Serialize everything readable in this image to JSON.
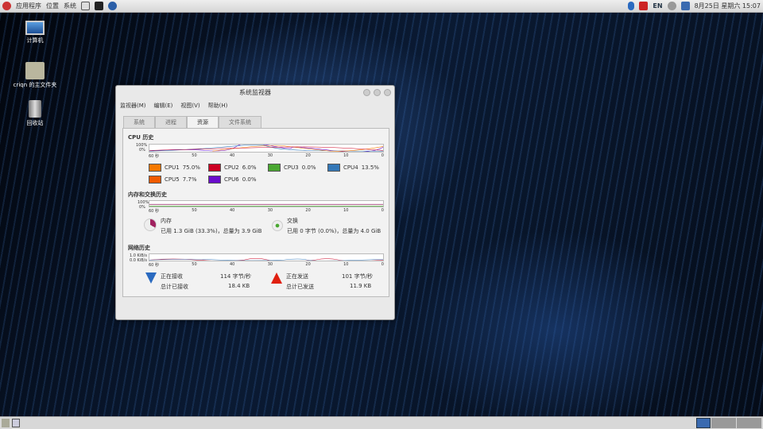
{
  "topbar": {
    "menus": [
      "应用程序",
      "位置",
      "系统"
    ],
    "lang": "EN",
    "clock": "8月25日 星期六 15:07"
  },
  "desktop": [
    {
      "label": "计算机"
    },
    {
      "label": "criqn 的主文件夹"
    },
    {
      "label": "回收站"
    }
  ],
  "window": {
    "title": "系统监视器",
    "menu": [
      "监视器(M)",
      "编辑(E)",
      "视图(V)",
      "帮助(H)"
    ],
    "tabs": [
      "系统",
      "进程",
      "资源",
      "文件系统"
    ],
    "active_tab": 2,
    "cpu": {
      "title": "CPU 历史",
      "y_labels": [
        "100%",
        "0%"
      ],
      "x_labels": [
        "60 秒",
        "50",
        "40",
        "30",
        "20",
        "10",
        "0"
      ],
      "cores": [
        {
          "name": "CPU1",
          "value": "75.0%",
          "color": "#f57900"
        },
        {
          "name": "CPU2",
          "value": "6.0%",
          "color": "#cc0022"
        },
        {
          "name": "CPU3",
          "value": "0.0%",
          "color": "#4aa832"
        },
        {
          "name": "CPU4",
          "value": "13.5%",
          "color": "#3478b8"
        },
        {
          "name": "CPU5",
          "value": "7.7%",
          "color": "#f05a00"
        },
        {
          "name": "CPU6",
          "value": "0.0%",
          "color": "#6a0dcc"
        }
      ]
    },
    "mem": {
      "title": "内存和交换历史",
      "y_labels": [
        "100%",
        "0%"
      ],
      "x_labels": [
        "60 秒",
        "50",
        "40",
        "30",
        "20",
        "10",
        "0"
      ],
      "memory_label": "内存",
      "memory_text": "已用 1.3 GiB (33.3%)，总量为 3.9 GiB",
      "swap_label": "交换",
      "swap_text": "已用 0 字节 (0.0%)，总量为 4.0 GiB",
      "memory_percent": 33.3,
      "swap_percent": 0
    },
    "net": {
      "title": "网络历史",
      "y_labels": [
        "1.0 KiB/s",
        "0.0 KiB/s"
      ],
      "x_labels": [
        "60 秒",
        "50",
        "40",
        "30",
        "20",
        "10",
        "0"
      ],
      "recv_label": "正在接收",
      "recv_rate": "114 字节/秒",
      "recv_total_label": "总计已接收",
      "recv_total": "18.4 KB",
      "send_label": "正在发送",
      "send_rate": "101 字节/秒",
      "send_total_label": "总计已发送",
      "send_total": "11.9 KB"
    }
  }
}
